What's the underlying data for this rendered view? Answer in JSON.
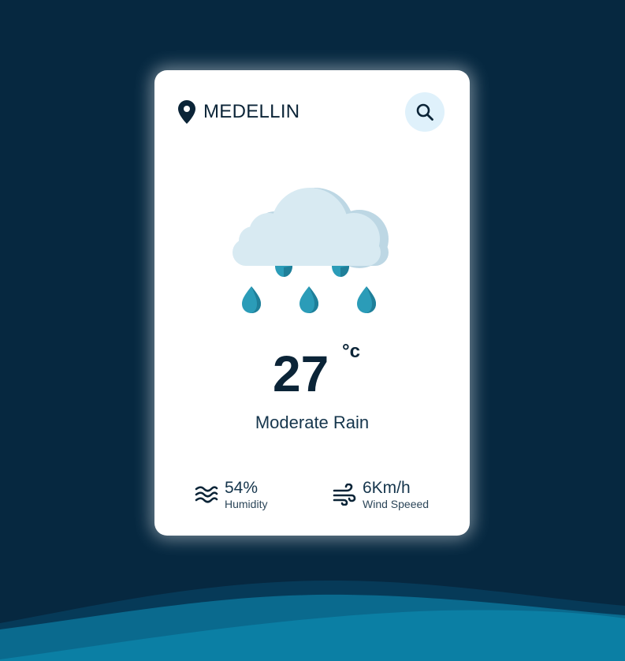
{
  "location": {
    "city": "MEDELLIN",
    "icon": "map-pin-icon"
  },
  "search": {
    "icon": "search-icon"
  },
  "weather": {
    "icon": "rain-cloud-icon",
    "temperature": "27",
    "unit": "°c",
    "description": "Moderate Rain"
  },
  "details": {
    "humidity": {
      "value": "54%",
      "label": "Humidity",
      "icon": "humidity-waves-icon"
    },
    "wind": {
      "value": "6Km/h",
      "label": "Wind Speeed",
      "icon": "wind-icon"
    }
  },
  "colors": {
    "background": "#062840",
    "card": "#ffffff",
    "text": "#0b2437",
    "search_bg": "#dff1fb",
    "cloud": "#d8eaf2",
    "cloud_shadow": "#bdd7e4",
    "drop": "#2b9cb8",
    "wave": "#0a7ba0"
  }
}
